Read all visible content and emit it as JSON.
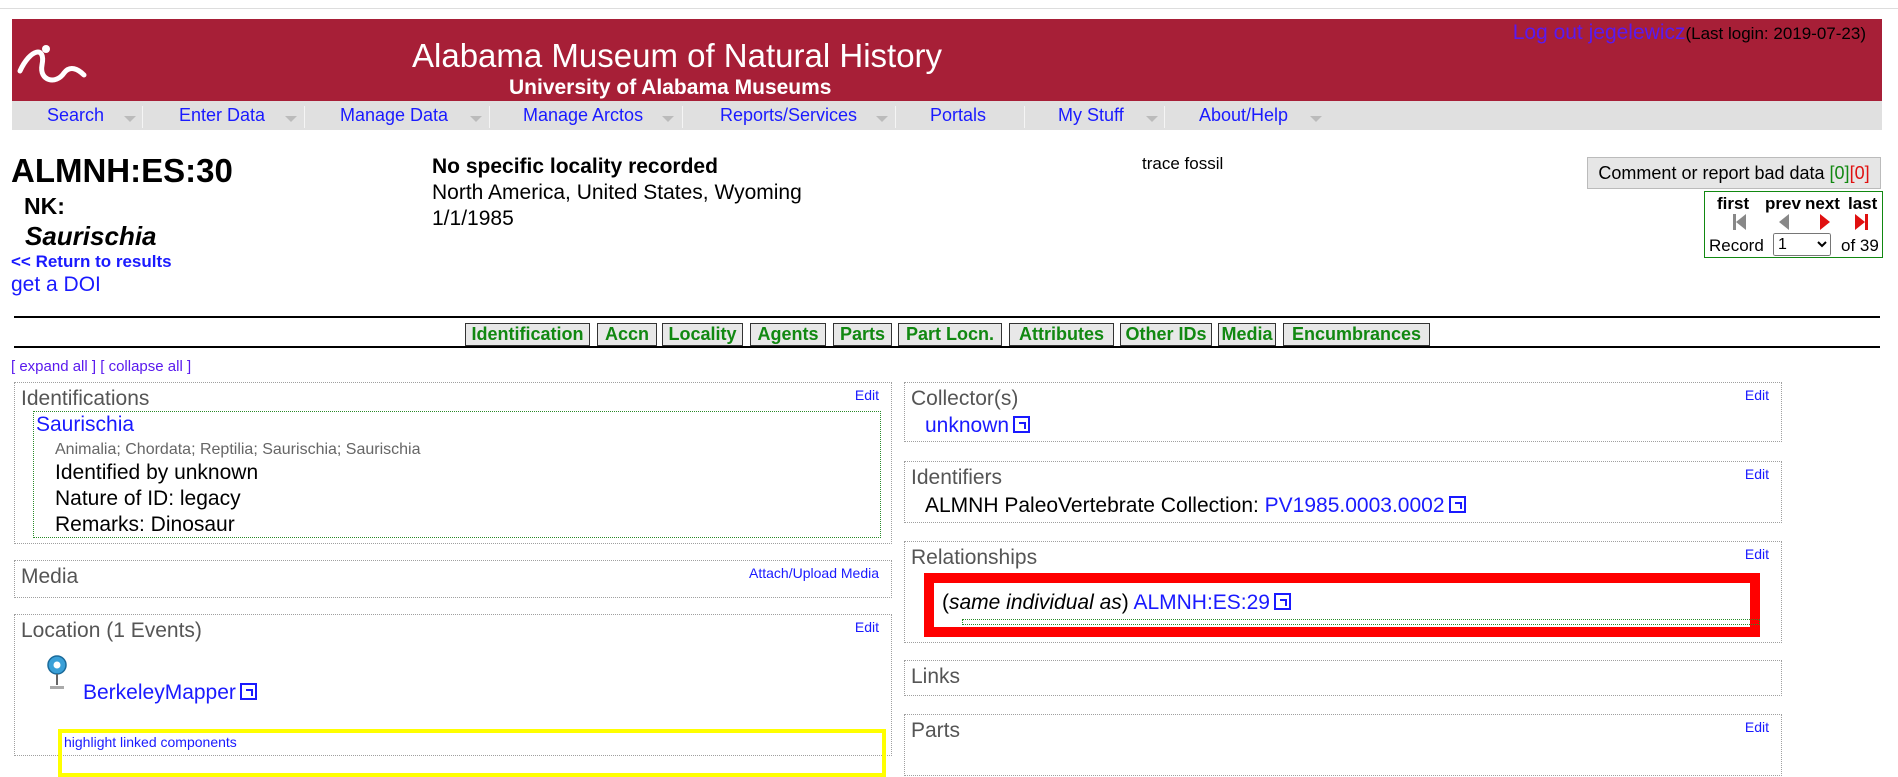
{
  "header": {
    "title": "Alabama Museum of Natural History",
    "subtitle": "University of Alabama Museums",
    "logout_link": "Log out jegelewicz",
    "last_login": "(Last login: 2019-07-23)"
  },
  "nav": {
    "items": [
      {
        "label": "Search"
      },
      {
        "label": "Enter Data"
      },
      {
        "label": "Manage Data"
      },
      {
        "label": "Manage Arctos"
      },
      {
        "label": "Reports/Services"
      },
      {
        "label": "Portals"
      },
      {
        "label": "My Stuff"
      },
      {
        "label": "About/Help"
      }
    ]
  },
  "record": {
    "guid": "ALMNH:ES:30",
    "nk": "NK:",
    "taxon": "Saurischia",
    "return_link": "<< Return to results",
    "doi_link": "get a DOI",
    "locality_title": "No specific locality recorded",
    "geography": "North America, United States, Wyoming",
    "date": "1/1/1985",
    "specimen_type": "trace fossil"
  },
  "comment": {
    "label": "Comment or report bad data ",
    "count_green": "[0]",
    "count_red": "[0]"
  },
  "pager": {
    "first": "first",
    "prev": "prev",
    "next": "next",
    "last": "last",
    "record_label": "Record",
    "current": "1",
    "of": "of 39"
  },
  "tabs": [
    "Identification",
    "Accn",
    "Locality",
    "Agents",
    "Parts",
    "Part Locn.",
    "Attributes",
    "Other IDs",
    "Media",
    "Encumbrances"
  ],
  "expand": {
    "expand_all": "[ expand all ]",
    "collapse_all": "[ collapse all ]"
  },
  "identifications": {
    "title": "Identifications",
    "edit": "Edit",
    "taxon": "Saurischia",
    "classification": "Animalia; Chordata; Reptilia; Saurischia; Saurischia",
    "identified_by": "Identified by unknown",
    "nature": "Nature of ID: legacy",
    "remarks": "Remarks: Dinosaur"
  },
  "media": {
    "title": "Media",
    "attach": "Attach/Upload Media"
  },
  "location": {
    "title": "Location (1 Events)",
    "edit": "Edit",
    "mapper": "BerkeleyMapper",
    "highlight": "highlight linked components"
  },
  "collectors": {
    "title": "Collector(s)",
    "edit": "Edit",
    "name": "unknown"
  },
  "identifiers": {
    "title": "Identifiers",
    "edit": "Edit",
    "label": "ALMNH PaleoVertebrate Collection: ",
    "value": "PV1985.0003.0002"
  },
  "relationships": {
    "title": "Relationships",
    "edit": "Edit",
    "type": "same individual as",
    "target": "ALMNH:ES:29"
  },
  "links": {
    "title": "Links"
  },
  "parts": {
    "title": "Parts",
    "edit": "Edit"
  },
  "colors": {
    "banner": "#a71f37",
    "link": "#1a1aff",
    "tab_text": "#118811",
    "relationship_border": "#ff0000",
    "highlight_border": "#ffff00"
  }
}
